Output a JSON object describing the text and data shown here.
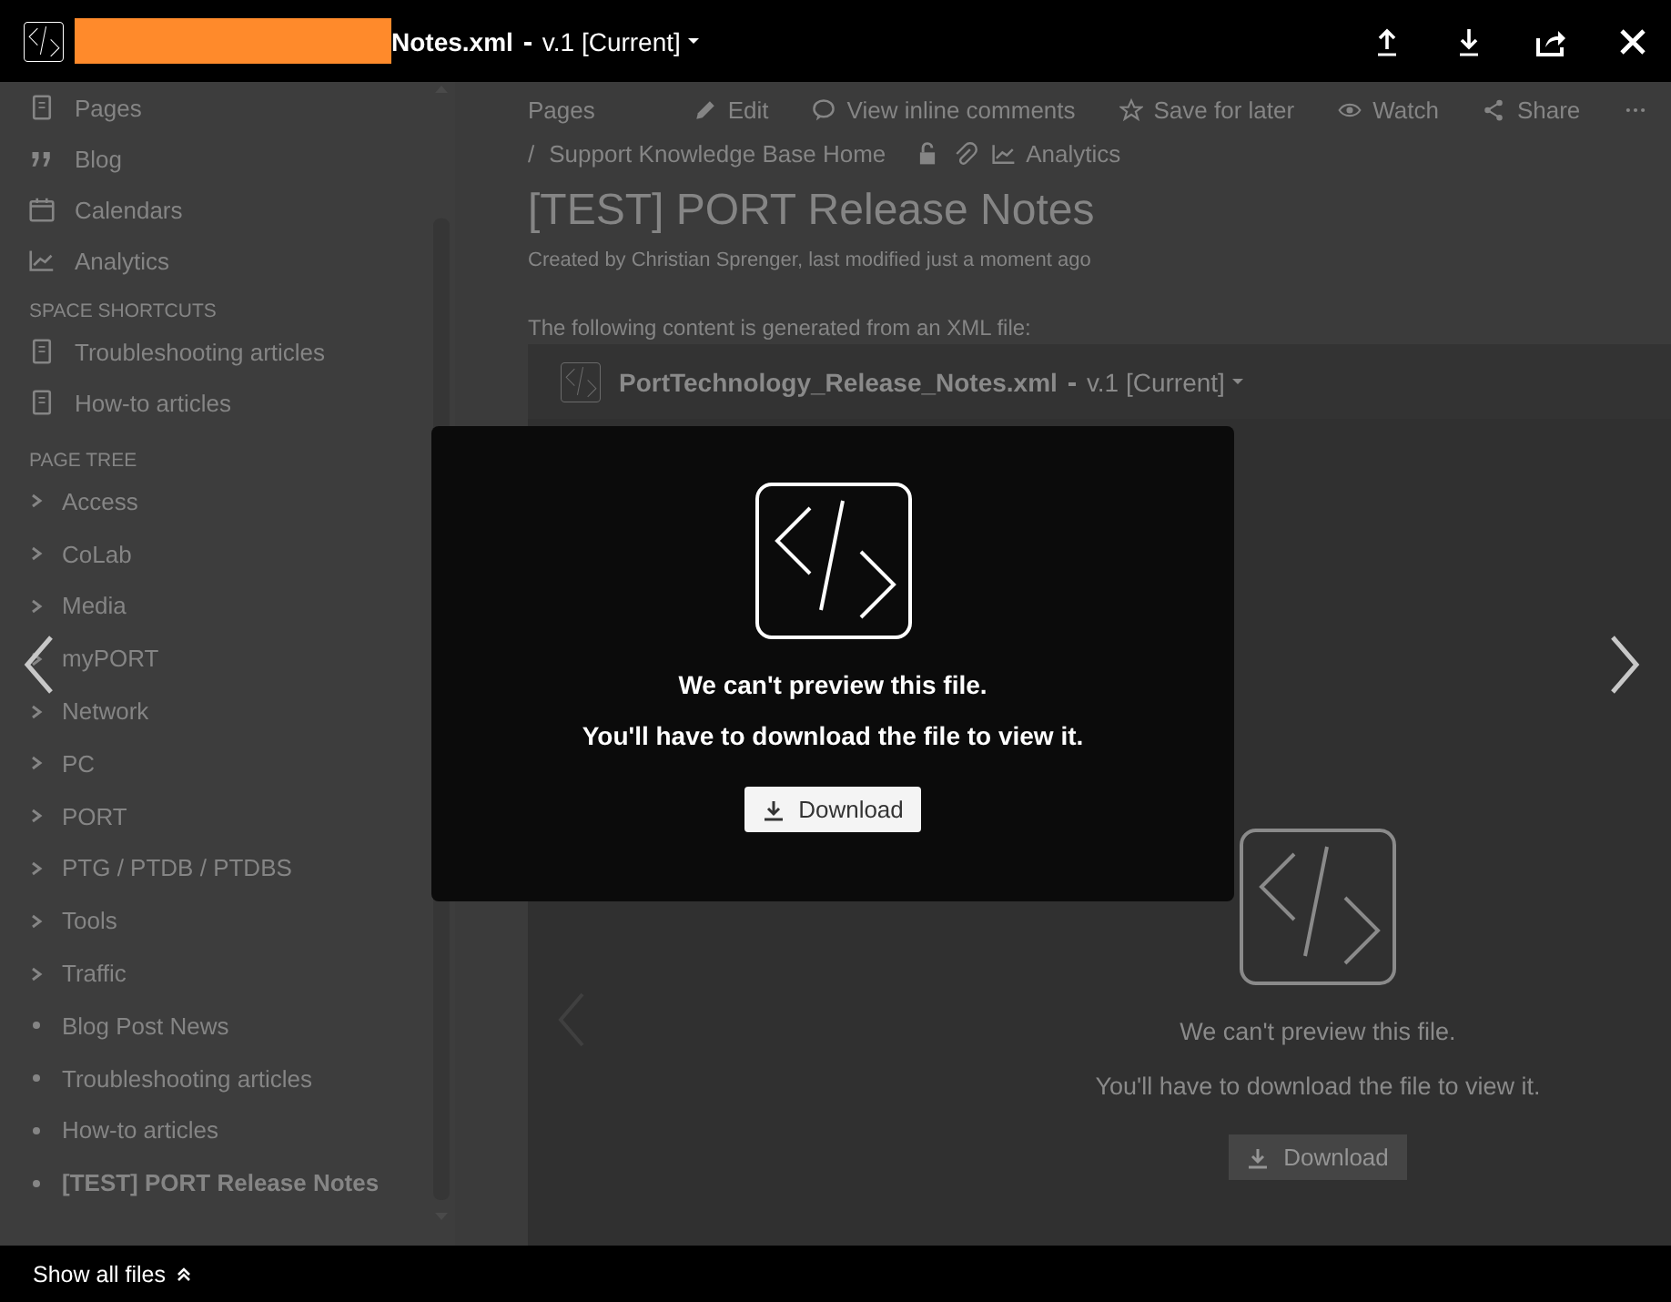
{
  "header": {
    "file_name": "Notes.xml",
    "version": "v.1 [Current]"
  },
  "sidebar": {
    "nav": [
      {
        "kind": "page",
        "label": "Pages"
      },
      {
        "kind": "quote",
        "label": "Blog"
      },
      {
        "kind": "calendar",
        "label": "Calendars"
      },
      {
        "kind": "chart",
        "label": "Analytics"
      }
    ],
    "shortcuts": {
      "heading": "SPACE SHORTCUTS",
      "items": [
        "Troubleshooting articles",
        "How-to articles"
      ]
    },
    "page_tree": {
      "heading": "PAGE TREE",
      "items": [
        {
          "kind": "folder",
          "label": "Access",
          "selected": false
        },
        {
          "kind": "folder",
          "label": "CoLab",
          "selected": false
        },
        {
          "kind": "folder",
          "label": "Media",
          "selected": false
        },
        {
          "kind": "folder",
          "label": "myPORT",
          "selected": false
        },
        {
          "kind": "folder",
          "label": "Network",
          "selected": false
        },
        {
          "kind": "folder",
          "label": "PC",
          "selected": false
        },
        {
          "kind": "folder",
          "label": "PORT",
          "selected": false
        },
        {
          "kind": "folder",
          "label": "PTG / PTDB / PTDBS",
          "selected": false
        },
        {
          "kind": "folder",
          "label": "Tools",
          "selected": false
        },
        {
          "kind": "folder",
          "label": "Traffic",
          "selected": false
        },
        {
          "kind": "leaf",
          "label": "Blog Post News",
          "selected": false
        },
        {
          "kind": "leaf",
          "label": "Troubleshooting articles",
          "selected": false
        },
        {
          "kind": "leaf",
          "label": "How-to articles",
          "selected": false
        },
        {
          "kind": "leaf",
          "label": "[TEST] PORT Release Notes",
          "selected": true
        }
      ]
    }
  },
  "page": {
    "toolbar": [
      {
        "kind": "text",
        "label": "Pages"
      },
      {
        "kind": "edit",
        "label": "Edit"
      },
      {
        "kind": "comment",
        "label": "View inline comments"
      },
      {
        "kind": "star",
        "label": "Save for later"
      },
      {
        "kind": "eye",
        "label": "Watch"
      },
      {
        "kind": "share",
        "label": "Share"
      },
      {
        "kind": "more"
      }
    ],
    "breadcrumb": {
      "separator": "/",
      "label": "Support Knowledge Base Home"
    },
    "analytics": "Analytics",
    "title": "[TEST] PORT Release Notes",
    "byline": "Created by Christian Sprenger, last modified just a moment ago",
    "intro": "The following content is generated from an XML file:",
    "embedded_viewer": {
      "file_name": "PortTechnology_Release_Notes.xml",
      "version": "v.1 [Current]",
      "message": "We can't preview this file.",
      "hint": "You'll have to download the file to view it.",
      "button": "Download"
    }
  },
  "preview": {
    "message": "We can't preview this file.",
    "hint": "You'll have to download the file to view it.",
    "button": "Download"
  },
  "footer": {
    "show_all": "Show all files"
  }
}
